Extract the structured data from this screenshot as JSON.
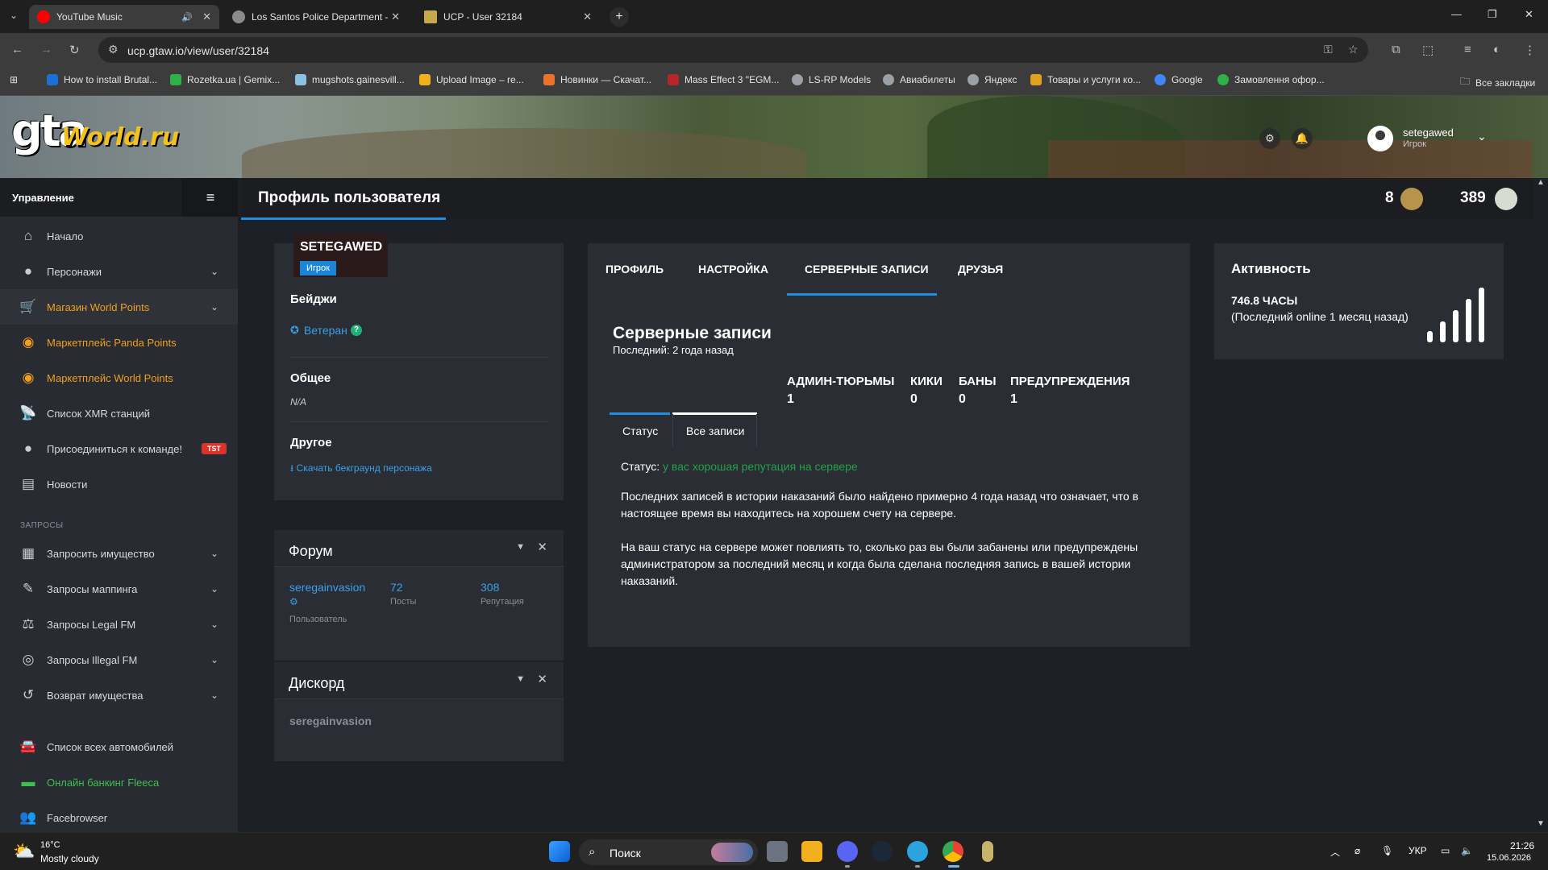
{
  "browser": {
    "tabs": [
      {
        "title": "YouTube Music",
        "color": "#ff0000"
      },
      {
        "title": "Los Santos Police Department -",
        "color": "#8a8a8a"
      },
      {
        "title": "UCP - User 32184",
        "color": "#c9a84a"
      }
    ],
    "url": "ucp.gtaw.io/view/user/32184",
    "bookmarks": [
      {
        "label": "How to install Brutal...",
        "color": "#1c6fd6"
      },
      {
        "label": "Rozetka.ua | Gemix...",
        "color": "#2fb14a"
      },
      {
        "label": "mugshots.gainesvill...",
        "color": "#8bc0e3"
      },
      {
        "label": "Upload Image – re...",
        "color": "#f2b01e"
      },
      {
        "label": "Новинки — Скачат...",
        "color": "#e8732b"
      },
      {
        "label": "Mass Effect 3 \"EGM...",
        "color": "#b5262b"
      },
      {
        "label": "LS-RP Models",
        "color": "#9aa0a6"
      },
      {
        "label": "Авиабилеты",
        "color": "#9aa0a6"
      },
      {
        "label": "Яндекс",
        "color": "#9aa0a6"
      },
      {
        "label": "Товары и услуги ко...",
        "color": "#e0a020"
      },
      {
        "label": "Google",
        "color": "#4285f4"
      },
      {
        "label": "Замовлення офор...",
        "color": "#2fb14a"
      }
    ],
    "all_bookmarks": "Все закладки"
  },
  "site": {
    "logo_gta": "gta",
    "logo_world": "World.ru",
    "user_name": "setegawed",
    "user_role": "Игрок"
  },
  "sidebar": {
    "title": "Управление",
    "items": [
      {
        "label": "Начало",
        "icon": "⌂"
      },
      {
        "label": "Персонажи",
        "icon": "●"
      },
      {
        "label": "Магазин World Points",
        "icon": "🛒"
      },
      {
        "label": "Маркетплейс Panda Points",
        "icon": "◉"
      },
      {
        "label": "Маркетплейс World Points",
        "icon": "◉"
      },
      {
        "label": "Список XMR станций",
        "icon": "📡"
      },
      {
        "label": "Присоединиться к команде!",
        "icon": "●"
      },
      {
        "label": "Новости",
        "icon": "▤"
      },
      {
        "label": "Запросить имущество",
        "icon": "▦"
      },
      {
        "label": "Запросы маппинга",
        "icon": "✎"
      },
      {
        "label": "Запросы Legal FM",
        "icon": "⚖"
      },
      {
        "label": "Запросы Illegal FM",
        "icon": "◎"
      },
      {
        "label": "Возврат имущества",
        "icon": "↺"
      },
      {
        "label": "Список всех автомобилей",
        "icon": "🚘"
      },
      {
        "label": "Онлайн банкинг Fleeca",
        "icon": "▬"
      },
      {
        "label": "Facebrowser",
        "icon": "👥"
      }
    ],
    "section_requests": "ЗАПРОСЫ",
    "team_badge": "TST"
  },
  "header": {
    "title": "Профиль пользователя",
    "stat1": "8",
    "stat2": "389"
  },
  "profile": {
    "name": "SETEGAWED",
    "role": "Игрок",
    "badges_label": "Бейджи",
    "badge": "Ветеран",
    "general_label": "Общее",
    "general_value": "N/A",
    "other_label": "Другое",
    "download_link": "Скачать бекграунд персонажа"
  },
  "forum": {
    "title": "Форум",
    "username": "seregainvasion",
    "role": "Пользователь",
    "posts": "72",
    "posts_label": "Посты",
    "reputation": "308",
    "reputation_label": "Репутация"
  },
  "discord": {
    "title": "Дискорд",
    "username": "seregainvasion"
  },
  "records": {
    "tabs": [
      "ПРОФИЛЬ",
      "НАСТРОЙКА",
      "СЕРВЕРНЫЕ ЗАПИСИ",
      "ДРУЗЬЯ"
    ],
    "title": "Серверные записи",
    "last": "Последний: 2 года назад",
    "stats": [
      {
        "label": "АДМИН-ТЮРЬМЫ",
        "value": "1"
      },
      {
        "label": "КИКИ",
        "value": "0"
      },
      {
        "label": "БАНЫ",
        "value": "0"
      },
      {
        "label": "ПРЕДУПРЕЖДЕНИЯ",
        "value": "1"
      }
    ],
    "subtabs": [
      "Статус",
      "Все записи"
    ],
    "status_label": "Статус:",
    "status_value": "у вас хорошая репутация на сервере",
    "para1": "Последних записей в истории наказаний было найдено примерно 4 года назад что означает, что в настоящее время вы находитесь на хорошем счету на сервере.",
    "para2": "На ваш статус на сервере может повлиять то, сколько раз вы были забанены или предупреждены администратором за последний месяц и когда была сделана последняя запись в вашей истории наказаний."
  },
  "activity": {
    "title": "Активность",
    "hours": "746.8 ЧАСЫ",
    "last_online": "(Последний online 1 месяц назад)"
  },
  "taskbar": {
    "temp": "16°C",
    "condition": "Mostly cloudy",
    "search": "Поиск",
    "lang": "УКР",
    "time": "21:26",
    "date": "15.06.2026"
  }
}
